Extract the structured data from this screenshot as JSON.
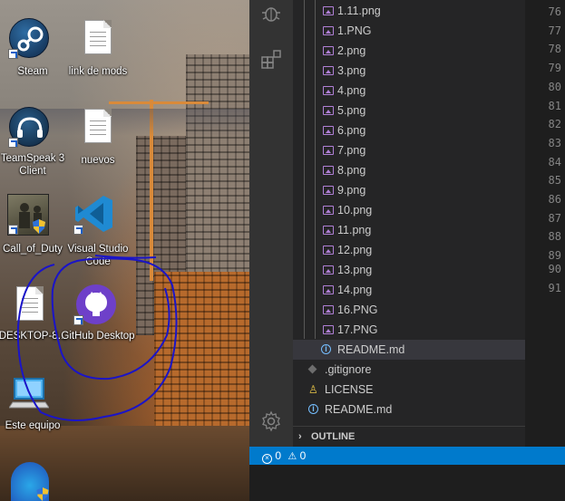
{
  "desktop": {
    "icons": [
      {
        "label": "Steam",
        "icon": "steam-icon"
      },
      {
        "label": "link de mods",
        "icon": "document-icon"
      },
      {
        "label": "TeamSpeak 3 Client",
        "icon": "teamspeak-icon"
      },
      {
        "label": "nuevos",
        "icon": "document-icon"
      },
      {
        "label": "Call_of_Duty",
        "icon": "call-of-duty-icon"
      },
      {
        "label": "Visual Studio Code",
        "icon": "vscode-icon"
      },
      {
        "label": "DESKTOP-8...",
        "icon": "document-icon"
      },
      {
        "label": "GitHub Desktop",
        "icon": "github-desktop-icon"
      },
      {
        "label": "Este equipo",
        "icon": "computer-icon"
      }
    ],
    "annotation_color": "#1a14c8"
  },
  "vscode": {
    "activity_icons": [
      "debug-icon",
      "extensions-icon",
      "settings-gear-icon"
    ],
    "explorer_items": [
      {
        "label": "1.11.png",
        "type": "image"
      },
      {
        "label": "1.PNG",
        "type": "image"
      },
      {
        "label": "2.png",
        "type": "image"
      },
      {
        "label": "3.png",
        "type": "image"
      },
      {
        "label": "4.png",
        "type": "image"
      },
      {
        "label": "5.png",
        "type": "image"
      },
      {
        "label": "6.png",
        "type": "image"
      },
      {
        "label": "7.png",
        "type": "image"
      },
      {
        "label": "8.png",
        "type": "image"
      },
      {
        "label": "9.png",
        "type": "image"
      },
      {
        "label": "10.png",
        "type": "image"
      },
      {
        "label": "11.png",
        "type": "image"
      },
      {
        "label": "12.png",
        "type": "image"
      },
      {
        "label": "13.png",
        "type": "image"
      },
      {
        "label": "14.png",
        "type": "image"
      },
      {
        "label": "16.PNG",
        "type": "image"
      },
      {
        "label": "17.PNG",
        "type": "image"
      },
      {
        "label": "README.md",
        "type": "info",
        "selected": true
      },
      {
        "label": ".gitignore",
        "type": "git"
      },
      {
        "label": "LICENSE",
        "type": "license"
      },
      {
        "label": "README.md",
        "type": "info"
      }
    ],
    "outline_label": "OUTLINE",
    "line_numbers": [
      "76",
      "77",
      "78",
      "79",
      "80",
      "81",
      "82",
      "83",
      "84",
      "85",
      "86",
      "87",
      "88",
      "89",
      "90",
      "91"
    ],
    "status": {
      "errors": "0",
      "warnings": "0"
    },
    "colors": {
      "accent": "#007acc",
      "image_icon": "#b180d7",
      "info_icon": "#75beff",
      "license_icon": "#e8c547"
    }
  }
}
